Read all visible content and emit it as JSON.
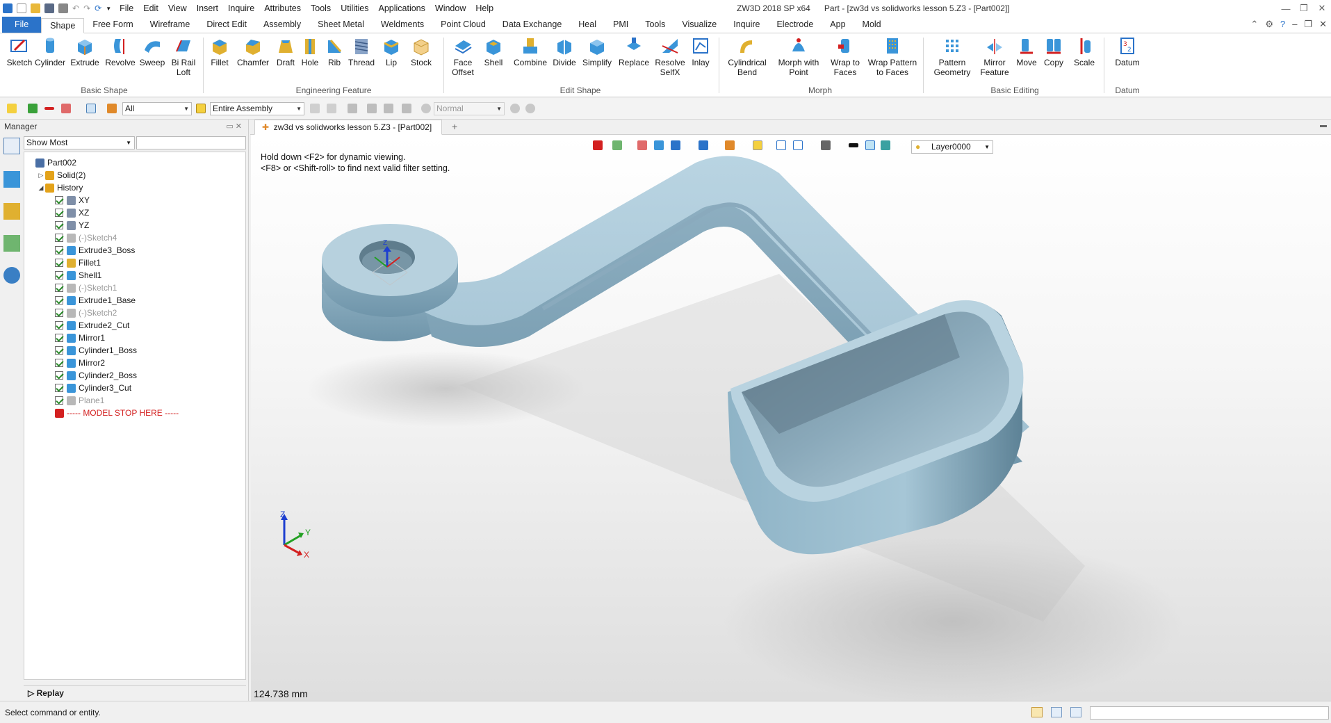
{
  "app": {
    "title": "ZW3D 2018 SP x64",
    "doc_title": "Part - [zw3d vs solidworks lesson 5.Z3 - [Part002]]"
  },
  "menus": [
    "File",
    "Edit",
    "View",
    "Insert",
    "Inquire",
    "Attributes",
    "Tools",
    "Utilities",
    "Applications",
    "Window",
    "Help"
  ],
  "ribbon_tabs": [
    "File",
    "Shape",
    "Free Form",
    "Wireframe",
    "Direct Edit",
    "Assembly",
    "Sheet Metal",
    "Weldments",
    "Point Cloud",
    "Data Exchange",
    "Heal",
    "PMI",
    "Tools",
    "Visualize",
    "Inquire",
    "Electrode",
    "App",
    "Mold"
  ],
  "ribbon": {
    "buttons": [
      "Sketch",
      "Cylinder",
      "Extrude",
      "Revolve",
      "Sweep",
      "Bi Rail\nLoft",
      "Fillet",
      "Chamfer",
      "Draft",
      "Hole",
      "Rib",
      "Thread",
      "Lip",
      "Stock",
      "Face\nOffset",
      "Shell",
      "Combine",
      "Divide",
      "Simplify",
      "Replace",
      "Resolve\nSelfX",
      "Inlay",
      "Cylindrical\nBend",
      "Morph with\nPoint",
      "Wrap to\nFaces",
      "Wrap Pattern\nto Faces",
      "Pattern\nGeometry",
      "Mirror\nFeature",
      "Move",
      "Copy",
      "Scale",
      "Datum"
    ],
    "groups": [
      "Basic Shape",
      "Engineering Feature",
      "Edit Shape",
      "Morph",
      "Basic Editing",
      "Datum"
    ]
  },
  "filter": {
    "type_value": "All",
    "scope_value": "Entire Assembly",
    "mode_value": "Normal"
  },
  "manager": {
    "title": "Manager",
    "show_value": "Show Most",
    "tree": [
      {
        "label": "Part002",
        "level": 0,
        "expander": "",
        "checked": false,
        "dim": false,
        "color": "#4a6fa5"
      },
      {
        "label": "Solid(2)",
        "level": 1,
        "expander": "▷",
        "checked": false,
        "dim": false,
        "color": "#e3a21a"
      },
      {
        "label": "History",
        "level": 1,
        "expander": "◢",
        "checked": false,
        "dim": false,
        "color": "#e3a21a"
      },
      {
        "label": "XY",
        "level": 2,
        "expander": "",
        "checked": true,
        "dim": false,
        "color": "#7f8fa8"
      },
      {
        "label": "XZ",
        "level": 2,
        "expander": "",
        "checked": true,
        "dim": false,
        "color": "#7f8fa8"
      },
      {
        "label": "YZ",
        "level": 2,
        "expander": "",
        "checked": true,
        "dim": false,
        "color": "#7f8fa8"
      },
      {
        "label": "(-)Sketch4",
        "level": 2,
        "expander": "",
        "checked": true,
        "dim": true,
        "color": "#b8b8b8"
      },
      {
        "label": "Extrude3_Boss",
        "level": 2,
        "expander": "",
        "checked": true,
        "dim": false,
        "color": "#3a95d9"
      },
      {
        "label": "Fillet1",
        "level": 2,
        "expander": "",
        "checked": true,
        "dim": false,
        "color": "#e0b030"
      },
      {
        "label": "Shell1",
        "level": 2,
        "expander": "",
        "checked": true,
        "dim": false,
        "color": "#3a95d9"
      },
      {
        "label": "(-)Sketch1",
        "level": 2,
        "expander": "",
        "checked": true,
        "dim": true,
        "color": "#b8b8b8"
      },
      {
        "label": "Extrude1_Base",
        "level": 2,
        "expander": "",
        "checked": true,
        "dim": false,
        "color": "#3a95d9"
      },
      {
        "label": "(-)Sketch2",
        "level": 2,
        "expander": "",
        "checked": true,
        "dim": true,
        "color": "#b8b8b8"
      },
      {
        "label": "Extrude2_Cut",
        "level": 2,
        "expander": "",
        "checked": true,
        "dim": false,
        "color": "#3a95d9"
      },
      {
        "label": "Mirror1",
        "level": 2,
        "expander": "",
        "checked": true,
        "dim": false,
        "color": "#3a95d9"
      },
      {
        "label": "Cylinder1_Boss",
        "level": 2,
        "expander": "",
        "checked": true,
        "dim": false,
        "color": "#3a95d9"
      },
      {
        "label": "Mirror2",
        "level": 2,
        "expander": "",
        "checked": true,
        "dim": false,
        "color": "#3a95d9"
      },
      {
        "label": "Cylinder2_Boss",
        "level": 2,
        "expander": "",
        "checked": true,
        "dim": false,
        "color": "#3a95d9"
      },
      {
        "label": "Cylinder3_Cut",
        "level": 2,
        "expander": "",
        "checked": true,
        "dim": false,
        "color": "#3a95d9"
      },
      {
        "label": "Plane1",
        "level": 2,
        "expander": "",
        "checked": true,
        "dim": true,
        "color": "#b8b8b8"
      },
      {
        "label": "----- MODEL STOP HERE -----",
        "level": 2,
        "expander": "",
        "checked": false,
        "dim": false,
        "stop": true,
        "color": "#d32020"
      }
    ],
    "replay_label": "Replay"
  },
  "doc_tab": {
    "label": "zw3d vs solidworks lesson 5.Z3 - [Part002]",
    "close": "✕"
  },
  "viewport": {
    "hint_1": "Hold down <F2> for dynamic viewing.",
    "hint_2": "<F8> or <Shift-roll> to find next valid filter setting.",
    "layer_value": "Layer0000",
    "measure": "124.738 mm",
    "axes": {
      "z": "Z",
      "y": "Y",
      "x": "X"
    }
  },
  "status": {
    "text": "Select command or entity."
  },
  "colors": {
    "accent": "#2b73c9",
    "model": "#a9c6d6",
    "stop_text": "#d32020"
  }
}
